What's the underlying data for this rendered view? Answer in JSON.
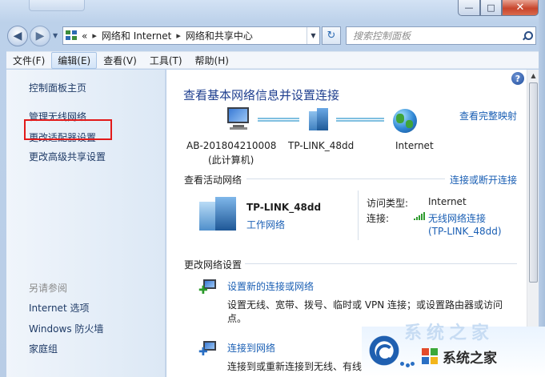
{
  "window": {
    "controls": {
      "minimize": "—",
      "maximize": "□",
      "close": "✕"
    }
  },
  "address_bar": {
    "overflow": "«",
    "crumbs": [
      "网络和 Internet",
      "网络和共享中心"
    ],
    "separator": "▸",
    "icon": "network-folder-icon"
  },
  "search": {
    "placeholder": "搜索控制面板"
  },
  "menu": {
    "items": [
      "文件(F)",
      "编辑(E)",
      "查看(V)",
      "工具(T)",
      "帮助(H)"
    ],
    "active_index": 1
  },
  "sidebar": {
    "home": "控制面板主页",
    "tasks": [
      "管理无线网络",
      "更改适配器设置",
      "更改高级共享设置"
    ],
    "highlighted_task_index": 1,
    "highlight_color": "#e21a1a",
    "see_also_heading": "另请参阅",
    "see_also": [
      "Internet 选项",
      "Windows 防火墙",
      "家庭组"
    ]
  },
  "main": {
    "title": "查看基本网络信息并设置连接",
    "full_map_link": "查看完整映射",
    "map": {
      "computer_name": "AB-201804210008",
      "computer_sub": "(此计算机)",
      "router_name": "TP-LINK_48dd",
      "internet_label": "Internet"
    },
    "active_networks": {
      "heading": "查看活动网络",
      "connect_link": "连接或断开连接",
      "network_name": "TP-LINK_48dd",
      "network_type": "工作网络",
      "access_type_label": "访问类型:",
      "access_type_value": "Internet",
      "connection_label": "连接:",
      "connection_value_line1": "无线网络连接",
      "connection_value_line2": "(TP-LINK_48dd)"
    },
    "change_settings": {
      "heading": "更改网络设置",
      "items": [
        {
          "title": "设置新的连接或网络",
          "desc_line1": "设置无线、宽带、拨号、临时或 VPN 连接；或设置路由器或访问",
          "desc_line2": "点。",
          "icon": "new-connection-icon"
        },
        {
          "title": "连接到网络",
          "desc_line1": "连接到或重新连接到无线、有线",
          "icon": "connect-network-icon"
        }
      ]
    }
  },
  "help_button": "?",
  "watermark": {
    "text": "系统之家",
    "faded_text": "系统之家"
  },
  "colors": {
    "link": "#1a5fb4",
    "title": "#1f3f8f",
    "accent_frame": "#b9cde6"
  }
}
